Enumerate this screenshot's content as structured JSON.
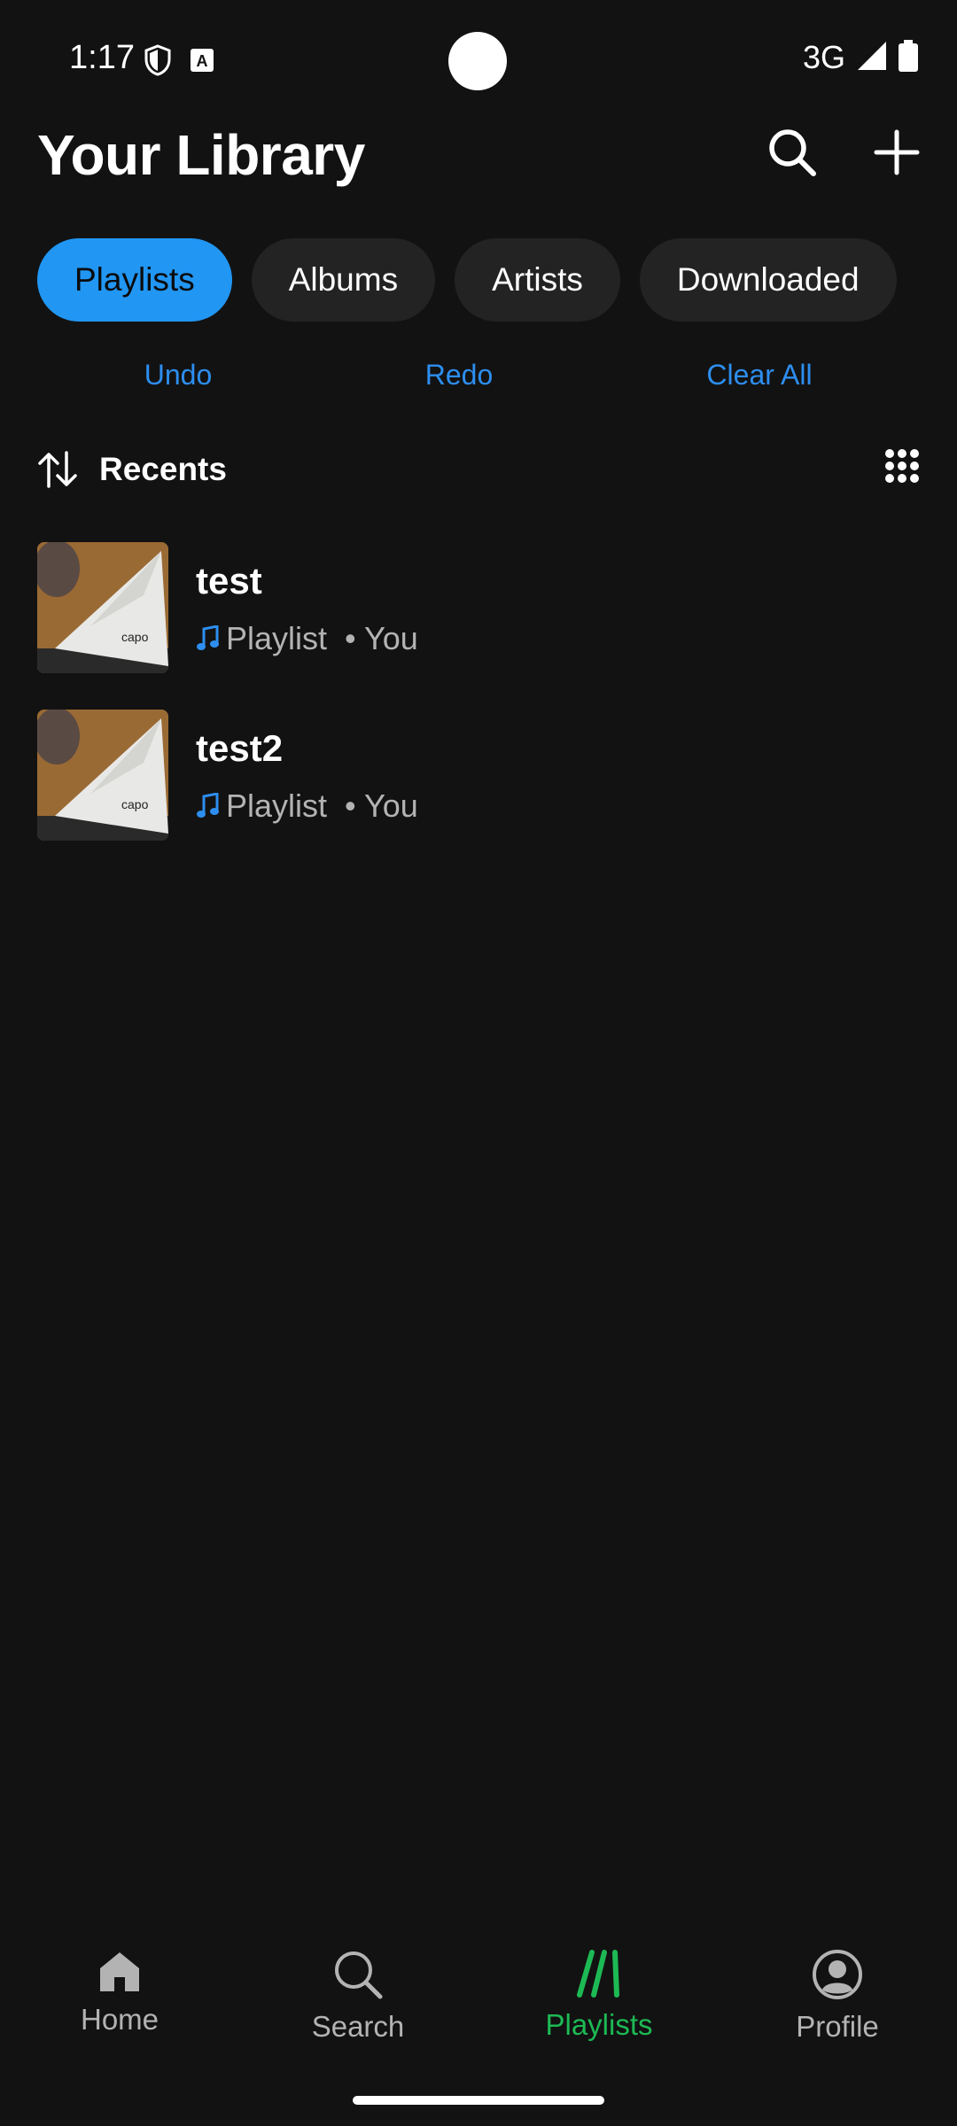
{
  "status": {
    "time": "1:17",
    "network": "3G"
  },
  "header": {
    "title": "Your Library"
  },
  "chips": [
    {
      "label": "Playlists",
      "active": true
    },
    {
      "label": "Albums"
    },
    {
      "label": "Artists"
    },
    {
      "label": "Downloaded"
    }
  ],
  "history": {
    "undo": "Undo",
    "redo": "Redo",
    "clear_all": "Clear All"
  },
  "sort": {
    "label": "Recents"
  },
  "items": [
    {
      "title": "test",
      "type": "Playlist",
      "owner": "• You"
    },
    {
      "title": "test2",
      "type": "Playlist",
      "owner": "• You"
    }
  ],
  "nav": [
    {
      "label": "Home",
      "icon": "home-icon"
    },
    {
      "label": "Search",
      "icon": "search-icon"
    },
    {
      "label": "Playlists",
      "icon": "playlists-icon",
      "active": true
    },
    {
      "label": "Profile",
      "icon": "profile-icon"
    }
  ],
  "colors": {
    "accent_blue": "#2196f3",
    "link_blue": "#2d8ef0",
    "active_green": "#1db954",
    "background": "#121212"
  }
}
